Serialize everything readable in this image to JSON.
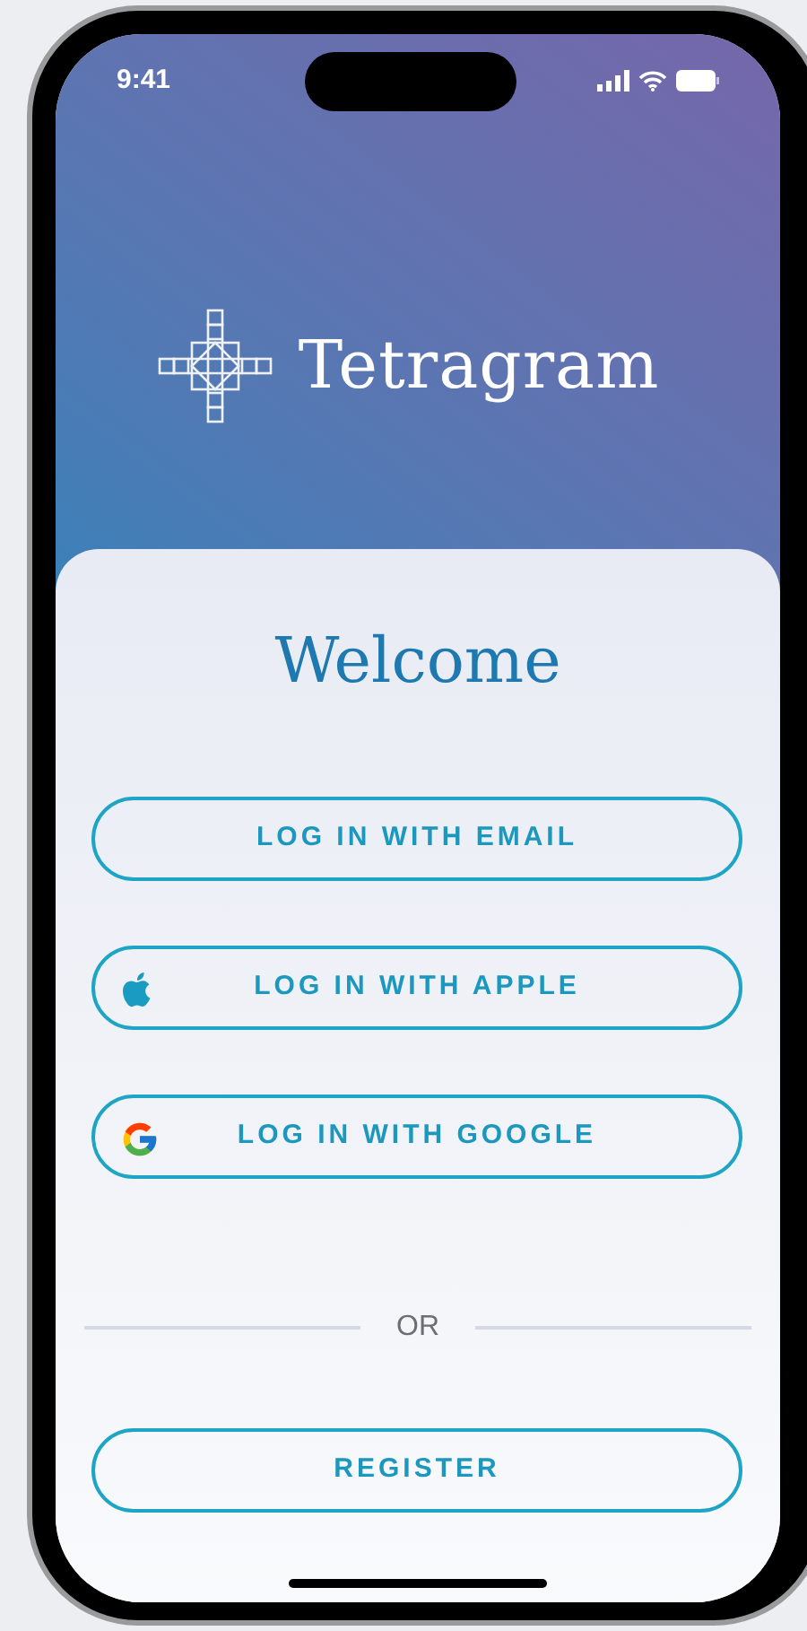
{
  "status_bar": {
    "time": "9:41"
  },
  "app": {
    "name": "Tetragram"
  },
  "welcome": {
    "title": "Welcome"
  },
  "login_buttons": [
    {
      "label": "LOG IN WITH EMAIL",
      "kind": "email"
    },
    {
      "label": "LOG IN WITH APPLE",
      "kind": "apple"
    },
    {
      "label": "LOG IN WITH GOOGLE",
      "kind": "google"
    }
  ],
  "divider": {
    "label": "OR"
  },
  "register_button": {
    "label": "REGISTER"
  }
}
